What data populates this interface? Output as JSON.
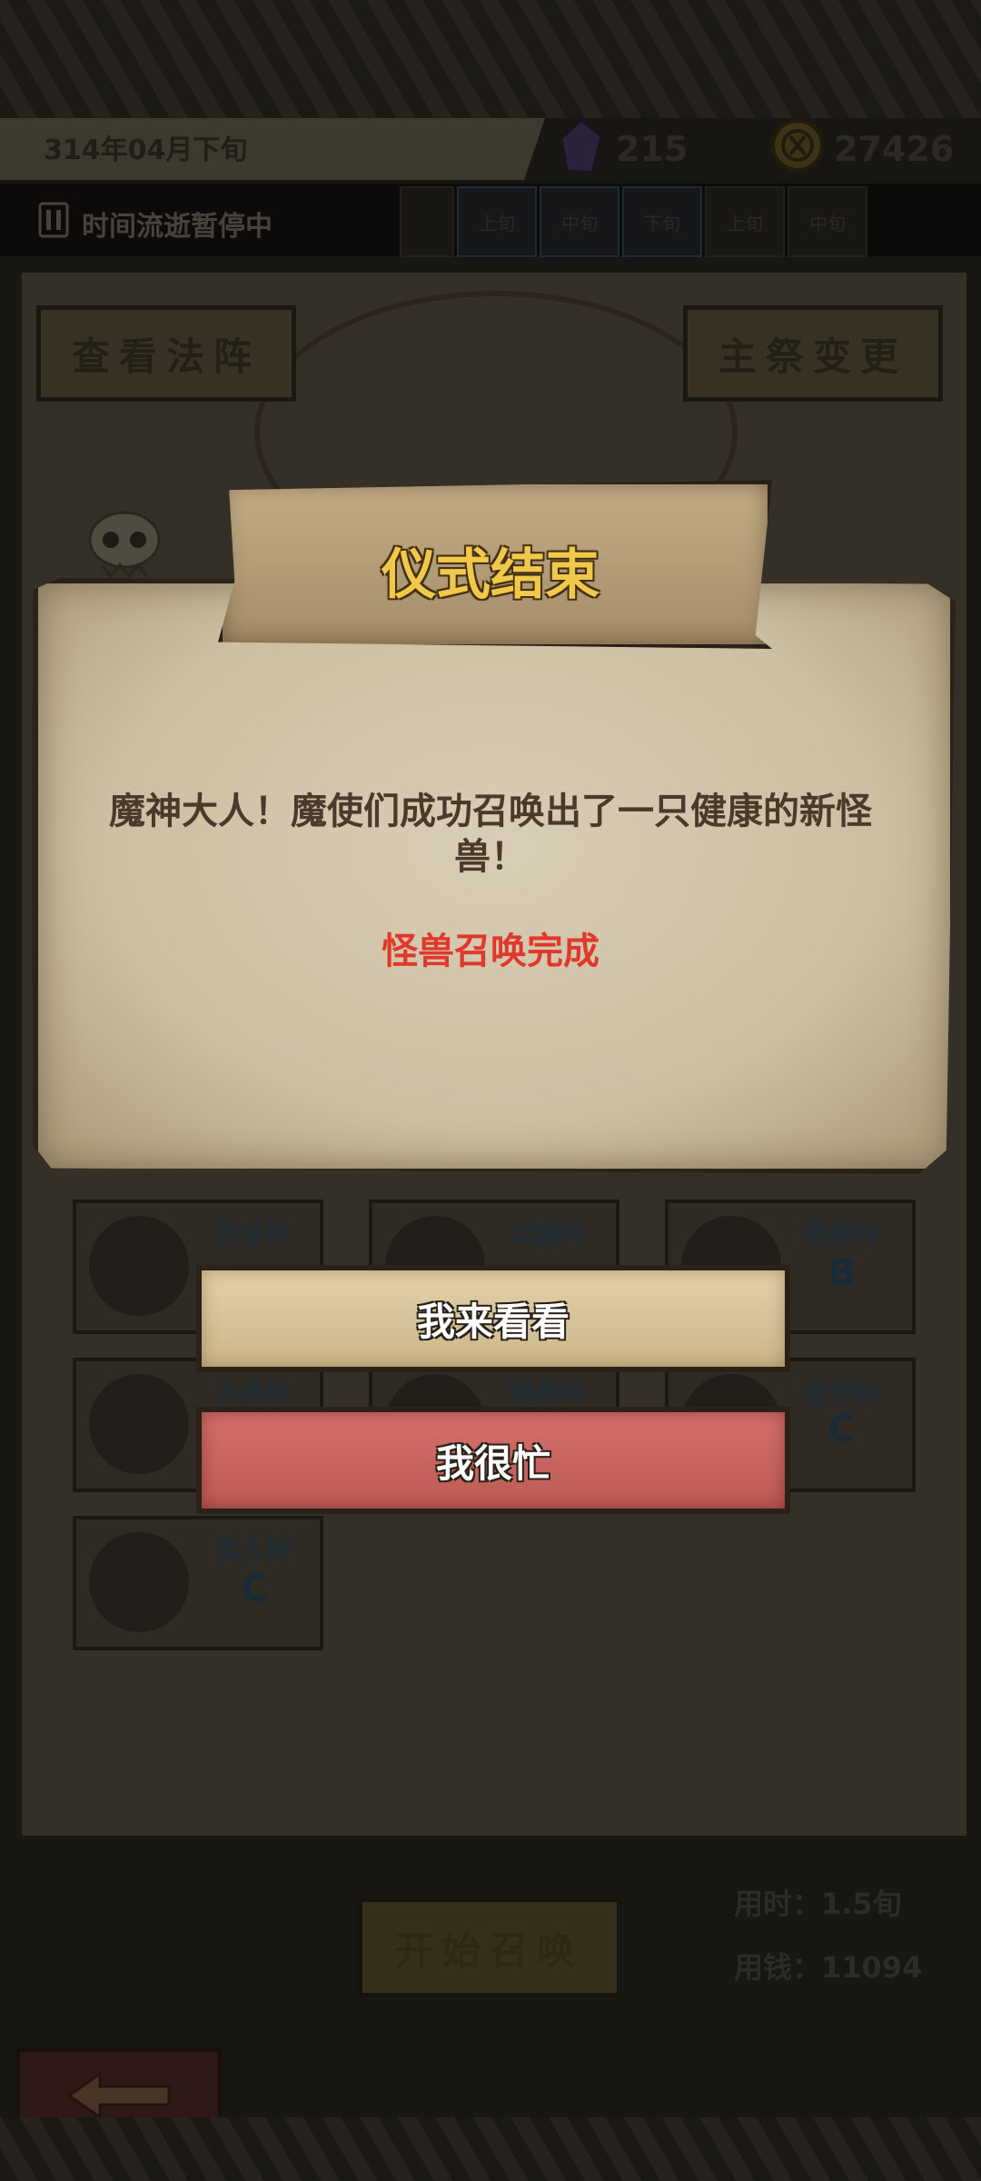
{
  "header": {
    "date": "314年04月下旬",
    "crystal_count": "215",
    "coin_count": "27426"
  },
  "time_bar": {
    "status": "时间流逝暂停中",
    "slots": [
      "上旬",
      "中旬",
      "下旬",
      "上旬",
      "中旬"
    ]
  },
  "board": {
    "view_formation_label": "查看法阵",
    "change_priest_label": "主祭变更",
    "species": [
      {
        "name": "昆虫种",
        "grade": ""
      },
      {
        "name": "兵魂种",
        "grade": ""
      },
      {
        "name": "恶魔种",
        "grade": "B"
      },
      {
        "name": "不死种",
        "grade": ""
      },
      {
        "name": "娜迦种",
        "grade": ""
      },
      {
        "name": "神圣种",
        "grade": "C"
      },
      {
        "name": "类人种",
        "grade": "C"
      }
    ],
    "start_summon_label": "开始召唤",
    "time_cost": "用时：1.5旬",
    "money_cost": "用钱：11094"
  },
  "modal": {
    "title": "仪式结束",
    "message": "魔神大人！魔使们成功召唤出了一只健康的新怪兽！",
    "status": "怪兽召唤完成",
    "confirm_label": "我来看看",
    "decline_label": "我很忙"
  },
  "colors": {
    "title_gold": "#f0c84a",
    "status_red": "#e0392c",
    "primary_button": "#cbb68a",
    "danger_button": "#bd5a55"
  },
  "icons": {
    "crystal": "crystal-icon",
    "coin": "coin-icon",
    "pause": "pause-icon",
    "back": "back-arrow-icon",
    "skull": "skull-icon"
  }
}
